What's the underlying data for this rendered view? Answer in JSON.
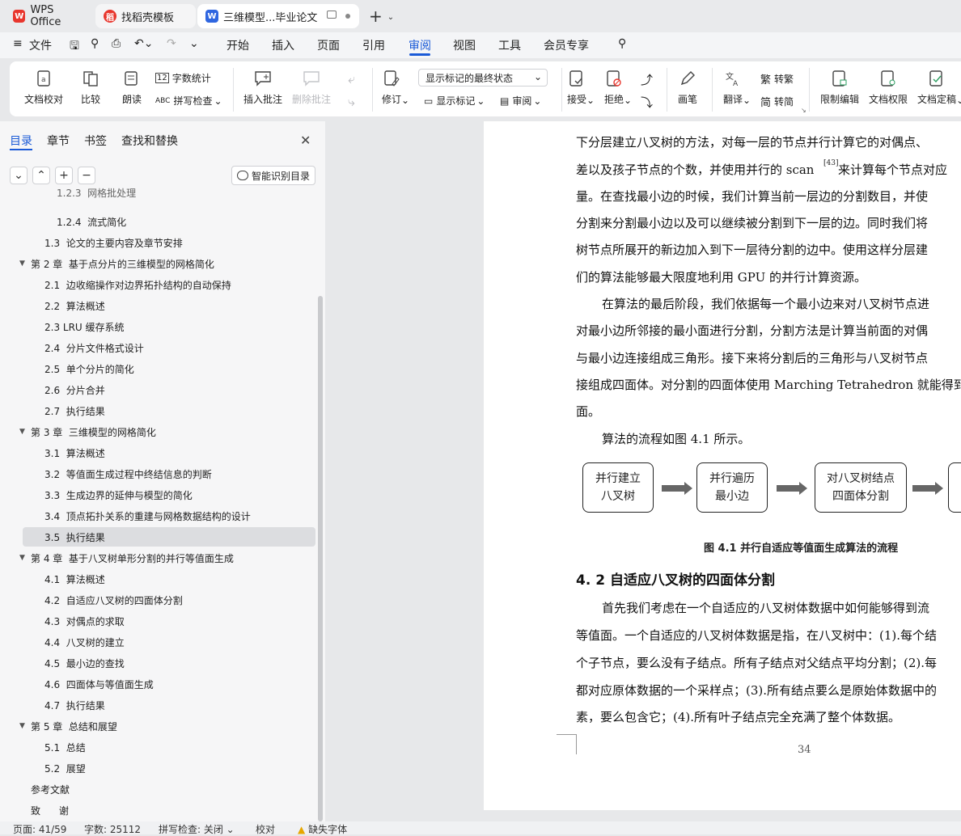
{
  "tabs": {
    "wps": "WPS Office",
    "templates": "找稻壳模板",
    "document": "三维模型...毕业论文",
    "new_tab": "+"
  },
  "menu": {
    "file": "文件",
    "items": [
      "开始",
      "插入",
      "页面",
      "引用",
      "审阅",
      "视图",
      "工具",
      "会员专享"
    ],
    "active": "审阅"
  },
  "ribbon": {
    "doc_proof": "文档校对",
    "compare": "比较",
    "read_aloud": "朗读",
    "word_count": "字数统计",
    "spell_check": "拼写检查",
    "insert_comment": "插入批注",
    "delete_comment": "删除批注",
    "track_changes": "修订",
    "markup_mode": "显示标记的最终状态",
    "show_markup": "显示标记",
    "review_pane": "审阅",
    "accept": "接受",
    "reject": "拒绝",
    "pen": "画笔",
    "translate": "翻译",
    "to_traditional": "转繁",
    "to_simplified": "转简",
    "traditional_char": "繁",
    "simplified_char": "简",
    "restrict_edit": "限制编辑",
    "doc_permissions": "文档权限",
    "doc_finalize": "文档定稿"
  },
  "nav": {
    "tabs": [
      "目录",
      "章节",
      "书签",
      "查找和替换"
    ],
    "smart_toc": "智能识别目录",
    "toc": [
      {
        "text": "1.2.3  网格批处理",
        "level": 2
      },
      {
        "text": "1.2.4  流式简化",
        "level": 2
      },
      {
        "text": "1.3  论文的主要内容及章节安排",
        "level": 1
      },
      {
        "text": "第 2 章  基于点分片的三维模型的网格简化",
        "level": 0
      },
      {
        "text": "2.1  边收缩操作对边界拓扑结构的自动保持",
        "level": 1
      },
      {
        "text": "2.2  算法概述",
        "level": 1
      },
      {
        "text": "2.3 LRU 缓存系统",
        "level": 1
      },
      {
        "text": "2.4  分片文件格式设计",
        "level": 1
      },
      {
        "text": "2.5  单个分片的简化",
        "level": 1
      },
      {
        "text": "2.6  分片合并",
        "level": 1
      },
      {
        "text": "2.7  执行结果",
        "level": 1
      },
      {
        "text": "第 3 章  三维模型的网格简化",
        "level": 0
      },
      {
        "text": "3.1  算法概述",
        "level": 1
      },
      {
        "text": "3.2  等值面生成过程中终结信息的判断",
        "level": 1
      },
      {
        "text": "3.3  生成边界的延伸与模型的简化",
        "level": 1
      },
      {
        "text": "3.4  顶点拓扑关系的重建与网格数据结构的设计",
        "level": 1
      },
      {
        "text": "3.5  执行结果",
        "level": 1,
        "selected": true
      },
      {
        "text": "第 4 章  基于八叉树单形分割的并行等值面生成",
        "level": 0
      },
      {
        "text": "4.1  算法概述",
        "level": 1
      },
      {
        "text": "4.2  自适应八叉树的四面体分割",
        "level": 1
      },
      {
        "text": "4.3  对偶点的求取",
        "level": 1
      },
      {
        "text": "4.4  八叉树的建立",
        "level": 1
      },
      {
        "text": "4.5  最小边的查找",
        "level": 1
      },
      {
        "text": "4.6  四面体与等值面生成",
        "level": 1
      },
      {
        "text": "4.7  执行结果",
        "level": 1
      },
      {
        "text": "第 5 章  总结和展望",
        "level": 0
      },
      {
        "text": "5.1  总结",
        "level": 1
      },
      {
        "text": "5.2  展望",
        "level": 1
      },
      {
        "text": "参考文献",
        "level": -1
      },
      {
        "text": "致      谢",
        "level": -1
      }
    ]
  },
  "document": {
    "lines": [
      "下分层建立八叉树的方法，对每一层的节点并行计算它的对偶点、",
      "差以及孩子节点的个数，并使用并行的 scan",
      "量。在查找最小边的时候，我们计算当前一层边的分割数目，并使",
      "分割来分割最小边以及可以继续被分割到下一层的边。同时我们将",
      "树节点所展开的新边加入到下一层待分割的边中。使用这样分层建",
      "们的算法能够最大限度地利用 GPU 的并行计算资源。",
      "在算法的最后阶段，我们依据每一个最小边来对八叉树节点进",
      "对最小边所邻接的最小面进行分割，分割方法是计算当前面的对偶",
      "与最小边连接组成三角形。接下来将分割后的三角形与八叉树节点",
      "接组成四面体。对分割的四面体使用 Marching Tetrahedron 就能得到",
      "面。",
      "算法的流程如图 4.1 所示。"
    ],
    "citation": "[43]",
    "line2_tail": "来计算每个节点对应",
    "flow_boxes": [
      "并行建立八叉树",
      "并行遍历最小边",
      "对八叉树结点四面体分割"
    ],
    "figure_caption": "图 4.1  并行自适应等值面生成算法的流程",
    "section_heading": "4. 2  自适应八叉树的四面体分割",
    "lines2": [
      "首先我们考虑在一个自适应的八叉树体数据中如何能够得到流",
      "等值面。一个自适应的八叉树体数据是指，在八叉树中：(1).每个结",
      "个子节点，要么没有子结点。所有子结点对父结点平均分割；(2).每",
      "都对应原体数据的一个采样点；(3).所有结点要么是原始体数据中的",
      "素，要么包含它；(4).所有叶子结点完全充满了整个体数据。"
    ],
    "page_number": "34"
  },
  "status": {
    "page": "页面: 41/59",
    "words": "字数: 25112",
    "spell": "拼写检查: 关闭",
    "proof": "校对",
    "missing_font": "缺失字体"
  },
  "colors": {
    "accent": "#1a5ad7",
    "wps_red": "#e8362d"
  }
}
